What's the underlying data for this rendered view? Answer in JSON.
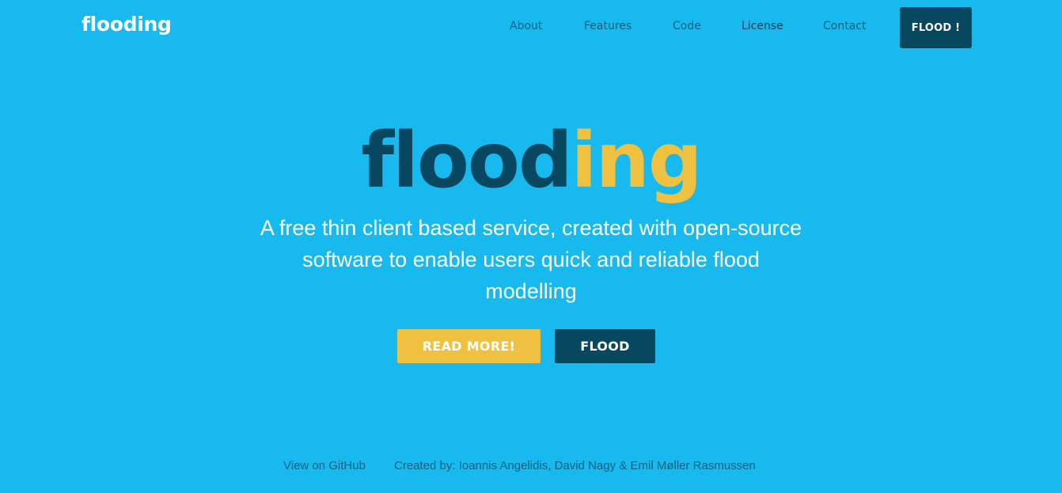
{
  "nav": {
    "brand": "flooding",
    "links": [
      {
        "label": "About"
      },
      {
        "label": "Features"
      },
      {
        "label": "Code"
      },
      {
        "label": "License"
      },
      {
        "label": "Contact"
      }
    ],
    "cta_label": "FLOOD !"
  },
  "hero": {
    "title_part1": "flood",
    "title_part2": "ing",
    "subtitle": "A free thin client based service, created with open-source software to enable users quick and reliable flood modelling",
    "read_more_label": "READ MORE!",
    "flood_label": "FLOOD"
  },
  "footer": {
    "github_label": "View on GitHub",
    "credit": "Created by: Ioannis Angelidis, David Nagy & Emil Møller Rasmussen"
  },
  "colors": {
    "background": "#18b9ef",
    "dark_blue": "#07475f",
    "accent_yellow": "#f0c040",
    "nav_text": "#0f5f7c"
  }
}
